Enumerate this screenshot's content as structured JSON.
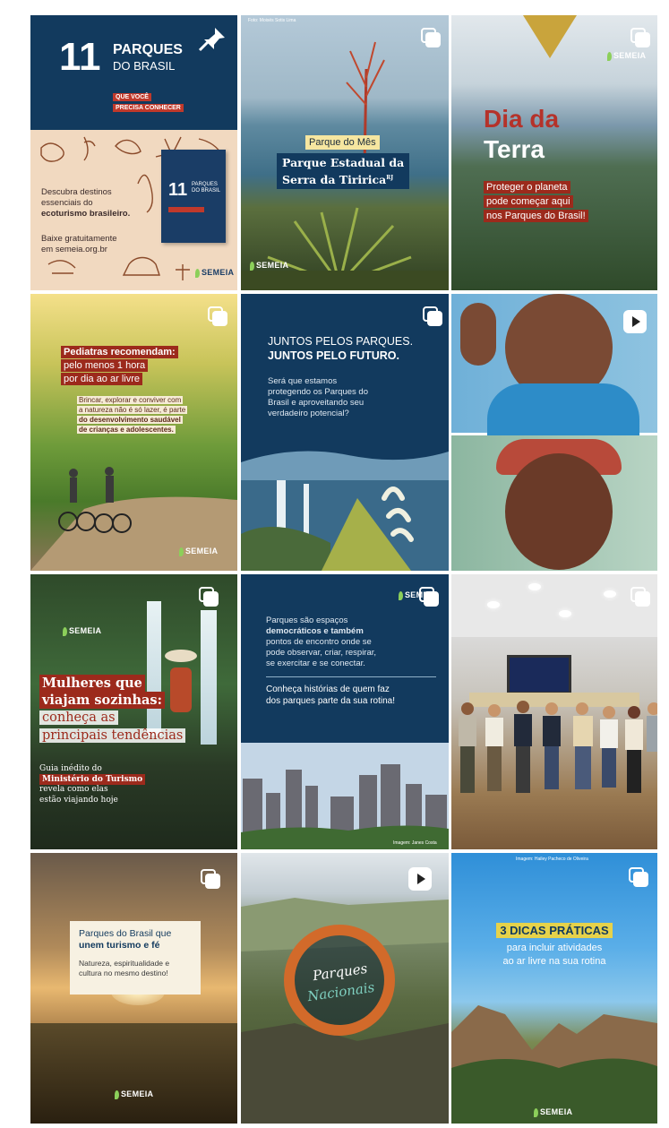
{
  "colors": {
    "navy": "#123a5e",
    "rust": "#9c2a1c",
    "green": "#6ea83a",
    "orange": "#d26a2a",
    "cream": "#f3e3c8"
  },
  "brand": "SEMEIA",
  "tiles": [
    {
      "id": 1,
      "badge": "pin-icon",
      "number": "11",
      "parques": "PARQUES",
      "do_brasil": "DO BRASIL",
      "ribbon1": "QUE VOCÊ",
      "ribbon2": "PRECISA CONHECER",
      "text1a": "Descubra destinos",
      "text1b": "essenciais do",
      "text1c": "ecoturismo brasileiro.",
      "text2a": "Baixe gratuitamente",
      "text2b": "em semeia.org.br",
      "book_number": "11",
      "book_text": "PARQUES DO BRASIL"
    },
    {
      "id": 2,
      "badge": "carousel-icon",
      "photo_credit": "Foto: Moisés Sotis Lima",
      "label": "Parque do Mês",
      "title1": "Parque Estadual da",
      "title2": "Serra da Tiririca",
      "sup": "RJ"
    },
    {
      "id": 3,
      "badge": "carousel-icon",
      "title1": "Dia da",
      "title2": "Terra",
      "line1": "Proteger o planeta",
      "line2": "pode começar aqui",
      "line3": "nos Parques do Brasil!"
    },
    {
      "id": 4,
      "badge": "carousel-icon",
      "h1": "Pediatras recomendam:",
      "h2": "pelo menos 1 hora",
      "h3": "por dia ao ar livre",
      "b1": "Brincar, explorar e conviver com",
      "b2": "a natureza não é só lazer, é parte",
      "b3": "do desenvolvimento saudável",
      "b4": "de crianças e adolescentes."
    },
    {
      "id": 5,
      "badge": "carousel-icon",
      "t1": "JUNTOS PELOS PARQUES.",
      "t2": "JUNTOS PELO FUTURO.",
      "q1": "Será que estamos",
      "q2": "protegendo os Parques do",
      "q3": "Brasil e aproveitando seu",
      "q4": "verdadeiro potencial?"
    },
    {
      "id": 6,
      "badge": "reel-icon"
    },
    {
      "id": 7,
      "badge": "carousel-icon",
      "h1": "Mulheres que",
      "h2": "viajam sozinhas:",
      "h3": "conheça as",
      "h4": "principais tendências",
      "s1": "Guia inédito do",
      "s2": "Ministério do Turismo",
      "s3": "revela como elas",
      "s4": "estão viajando hoje"
    },
    {
      "id": 8,
      "badge": "carousel-icon",
      "p1": "Parques são espaços",
      "p2": "democráticos e também",
      "p3": "pontos de encontro onde se",
      "p4": "pode observar, criar, respirar,",
      "p5": "se exercitar e se conectar.",
      "c1": "Conheça histórias de quem faz",
      "c2": "dos parques parte da sua rotina!",
      "credit": "Imagem: Janes Costa"
    },
    {
      "id": 9,
      "badge": "carousel-icon"
    },
    {
      "id": 10,
      "badge": "carousel-icon",
      "t1": "Parques do Brasil que",
      "t2": "unem turismo e fé",
      "s1": "Natureza, espiritualidade e",
      "s2": "cultura no mesmo destino!"
    },
    {
      "id": 11,
      "badge": "reel-icon",
      "script1": "Parques",
      "script2": "Nacionais"
    },
    {
      "id": 12,
      "badge": "carousel-icon",
      "credit": "Imagem: Hailey Pacheco de Oliveira",
      "h1": "3 DICAS PRÁTICAS",
      "h2": "para incluir atividades",
      "h3": "ao ar livre na sua rotina"
    }
  ]
}
